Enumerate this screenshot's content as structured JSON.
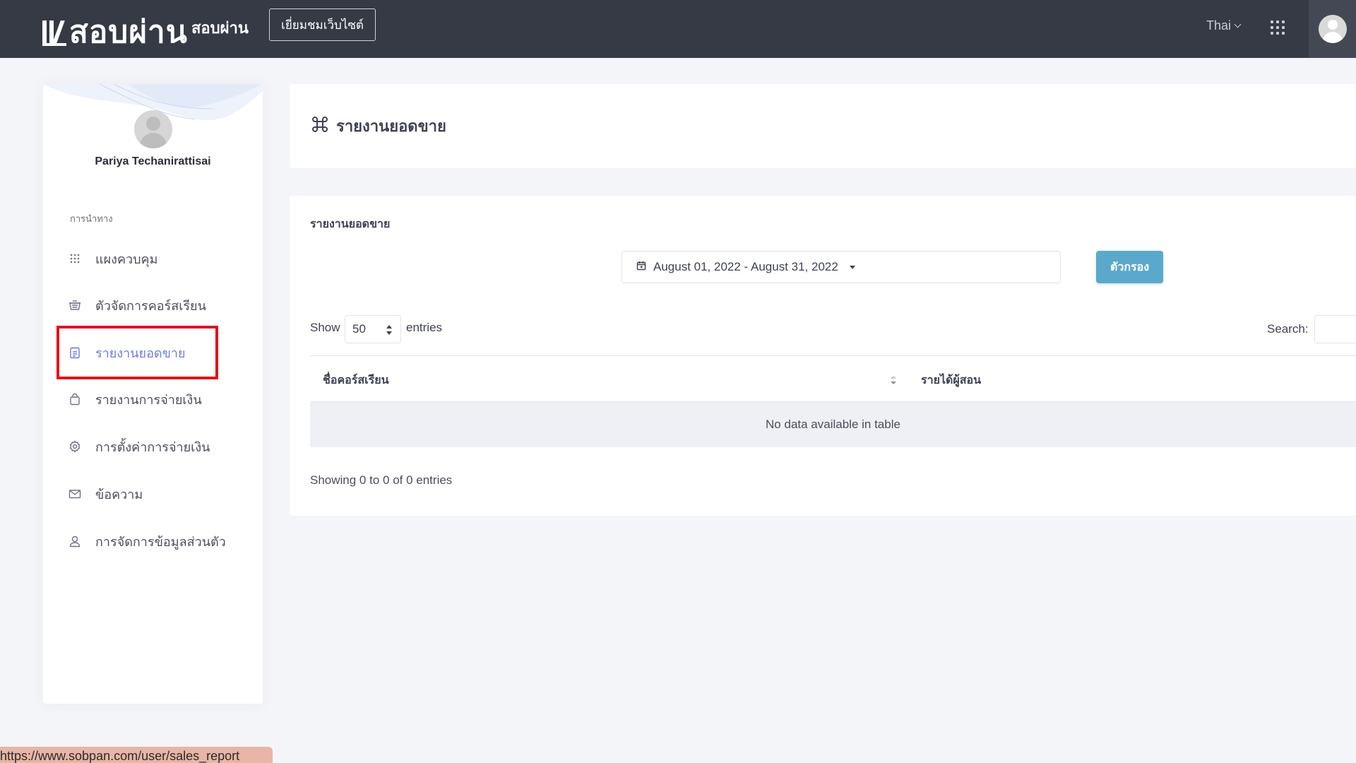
{
  "header": {
    "logo_text": "สอบผ่าน",
    "brand_sub": "สอบผ่าน",
    "visit_site_label": "เยี่ยมชมเว็บไซต์",
    "language": "Thai"
  },
  "sidebar": {
    "user_name": "Pariya Techanirattisai",
    "nav_heading": "การนำทาง",
    "items": [
      {
        "label": "แผงควบคุม",
        "icon": "grid-dots-icon"
      },
      {
        "label": "ตัวจัดการคอร์สเรียน",
        "icon": "basket-icon"
      },
      {
        "label": "รายงานยอดขาย",
        "icon": "report-icon",
        "active": true
      },
      {
        "label": "รายงานการจ่ายเงิน",
        "icon": "bag-icon"
      },
      {
        "label": "การตั้งค่าการจ่ายเงิน",
        "icon": "gear-icon"
      },
      {
        "label": "ข้อความ",
        "icon": "mail-icon"
      },
      {
        "label": "การจัดการข้อมูลส่วนตัว",
        "icon": "user-icon"
      }
    ]
  },
  "page": {
    "title": "รายงานยอดขาย",
    "title_icon": "command-icon"
  },
  "report": {
    "subtitle": "รายงานยอดขาย",
    "date_range": "August 01, 2022 - August 31, 2022",
    "filter_label": "ตัวกรอง",
    "show_label": "Show",
    "page_size": "50",
    "entries_label": "entries",
    "search_label": "Search:",
    "columns": [
      "ชื่อคอร์สเรียน",
      "รายได้ผู้สอน"
    ],
    "empty_text": "No data available in table",
    "info_text": "Showing 0 to 0 of 0 entries"
  },
  "status_url": "https://www.sobpan.com/user/sales_report",
  "colors": {
    "topbar": "#353a45",
    "accent": "#6d7ce0",
    "filter_button": "#5aa9cc",
    "highlight": "#e0141e"
  }
}
